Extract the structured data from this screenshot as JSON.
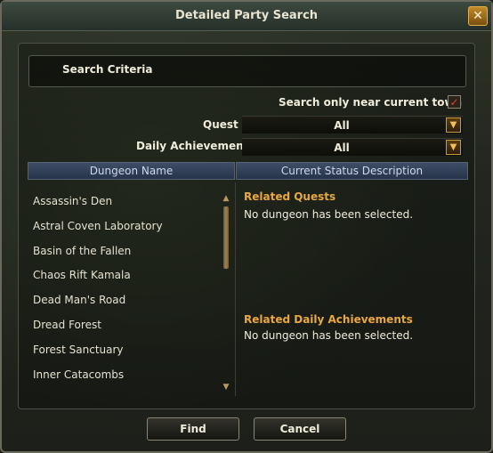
{
  "window": {
    "title": "Detailed Party Search"
  },
  "criteria": {
    "header": "Search Criteria",
    "near_town_label": "Search only near current town",
    "near_town_checked_mark": "✓",
    "quest_label": "Quest",
    "quest_value": "All",
    "daily_label": "Daily Achievement",
    "daily_value": "All"
  },
  "columns": {
    "dungeon": "Dungeon Name",
    "status": "Current Status Description"
  },
  "dungeons": [
    "Assassin's Den",
    "Astral Coven Laboratory",
    "Basin of the Fallen",
    "Chaos Rift Kamala",
    "Dead Man's Road",
    "Dread Forest",
    "Forest Sanctuary",
    "Inner Catacombs"
  ],
  "status": {
    "quests_title": "Related Quests",
    "quests_text": "No dungeon has been selected.",
    "daily_title": "Related Daily Achievements",
    "daily_text": "No dungeon has been selected."
  },
  "buttons": {
    "find": "Find",
    "cancel": "Cancel"
  },
  "icons": {
    "close": "close-icon",
    "dropdown": "chevron-down-icon"
  },
  "colors": {
    "accent": "#e8a840",
    "header_blue": "#26334a"
  }
}
